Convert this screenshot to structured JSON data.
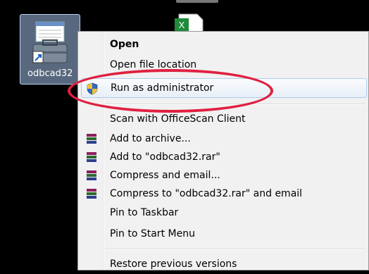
{
  "desktop": {
    "icon1_label": "odbcad32",
    "icon1_icon": "toolbox-icon",
    "icon2_icon": "excel-file-icon"
  },
  "context_menu": {
    "items": [
      {
        "label": "Open",
        "bold": true,
        "icon": null
      },
      {
        "label": "Open file location",
        "icon": null
      },
      {
        "label": "Run as administrator",
        "icon": "uac-shield-icon"
      },
      {
        "label": "Scan with OfficeScan Client",
        "icon": null
      },
      {
        "label": "Add to archive...",
        "icon": "winrar-icon"
      },
      {
        "label": "Add to \"odbcad32.rar\"",
        "icon": "winrar-icon"
      },
      {
        "label": "Compress and email...",
        "icon": "winrar-icon"
      },
      {
        "label": "Compress to \"odbcad32.rar\" and email",
        "icon": "winrar-icon"
      },
      {
        "label": "Pin to Taskbar",
        "icon": null
      },
      {
        "label": "Pin to Start Menu",
        "icon": null
      },
      {
        "label": "Restore previous versions",
        "icon": null
      }
    ]
  },
  "annotation": {
    "highlight_color": "#e02040"
  }
}
